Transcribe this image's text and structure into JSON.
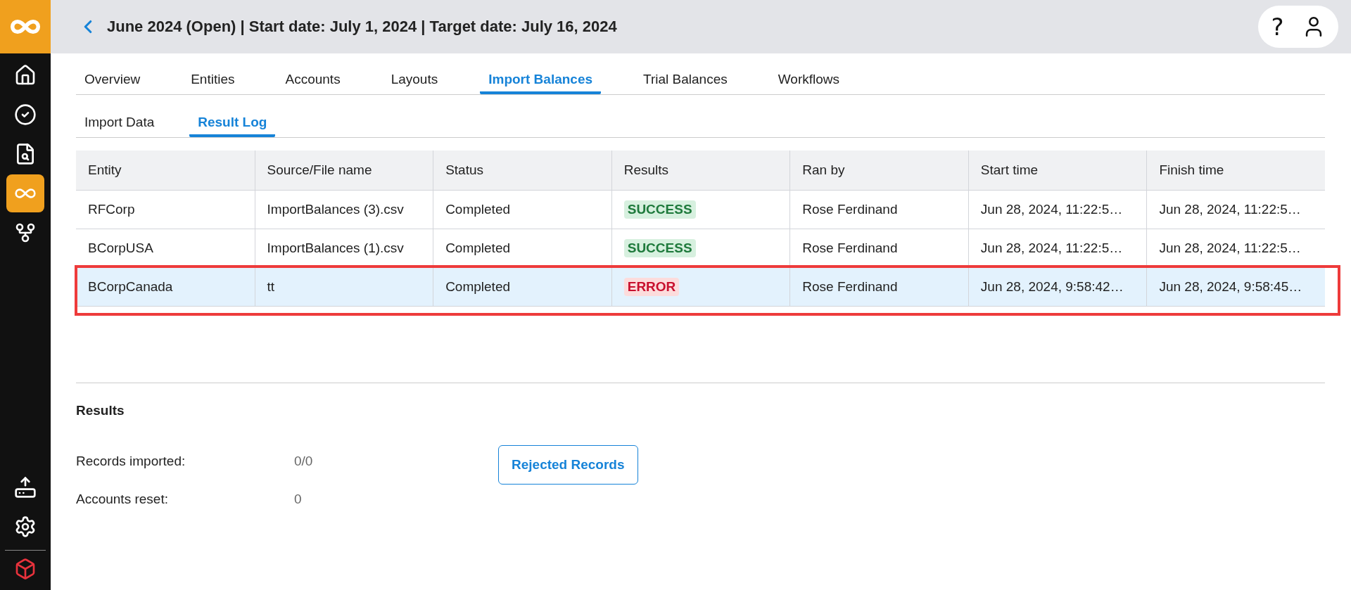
{
  "sidebar": {
    "items": [
      {
        "kind": "home",
        "selected": false
      },
      {
        "kind": "check",
        "selected": false
      },
      {
        "kind": "review",
        "selected": false
      },
      {
        "kind": "infinity",
        "selected": true
      },
      {
        "kind": "fork",
        "selected": false
      }
    ],
    "bottom_items": [
      {
        "kind": "upload",
        "selected": false
      },
      {
        "kind": "settings",
        "selected": false
      }
    ]
  },
  "header": {
    "title": "June 2024 (Open) | Start date: July 1, 2024 | Target date: July 16, 2024",
    "help": "?"
  },
  "tabs": [
    {
      "label": "Overview",
      "selected": false
    },
    {
      "label": "Entities",
      "selected": false
    },
    {
      "label": "Accounts",
      "selected": false
    },
    {
      "label": "Layouts",
      "selected": false
    },
    {
      "label": "Import Balances",
      "selected": true
    },
    {
      "label": "Trial Balances",
      "selected": false
    },
    {
      "label": "Workflows",
      "selected": false
    }
  ],
  "subtabs": [
    {
      "label": "Import Data",
      "selected": false
    },
    {
      "label": "Result Log",
      "selected": true
    }
  ],
  "table": {
    "columns": [
      "Entity",
      "Source/File name",
      "Status",
      "Results",
      "Ran by",
      "Start time",
      "Finish time"
    ],
    "rows": [
      {
        "selected": false,
        "cells": [
          "RFCorp",
          "ImportBalances (3).csv",
          "Completed",
          {
            "kind": "success",
            "text": "SUCCESS"
          },
          "Rose Ferdinand",
          "Jun 28, 2024, 11:22:5…",
          "Jun 28, 2024, 11:22:5…"
        ]
      },
      {
        "selected": false,
        "cells": [
          "BCorpUSA",
          "ImportBalances (1).csv",
          "Completed",
          {
            "kind": "success",
            "text": "SUCCESS"
          },
          "Rose Ferdinand",
          "Jun 28, 2024, 11:22:5…",
          "Jun 28, 2024, 11:22:5…"
        ]
      },
      {
        "selected": true,
        "cells": [
          "BCorpCanada",
          "tt",
          "Completed",
          {
            "kind": "error",
            "text": "ERROR"
          },
          "Rose Ferdinand",
          "Jun 28, 2024, 9:58:42…",
          "Jun 28, 2024, 9:58:45…"
        ]
      }
    ]
  },
  "results": {
    "title": "Results",
    "fields": [
      {
        "label": "Records imported:",
        "value": "0/0"
      },
      {
        "label": "Accounts reset:",
        "value": "0"
      }
    ],
    "button": "Rejected Records"
  }
}
